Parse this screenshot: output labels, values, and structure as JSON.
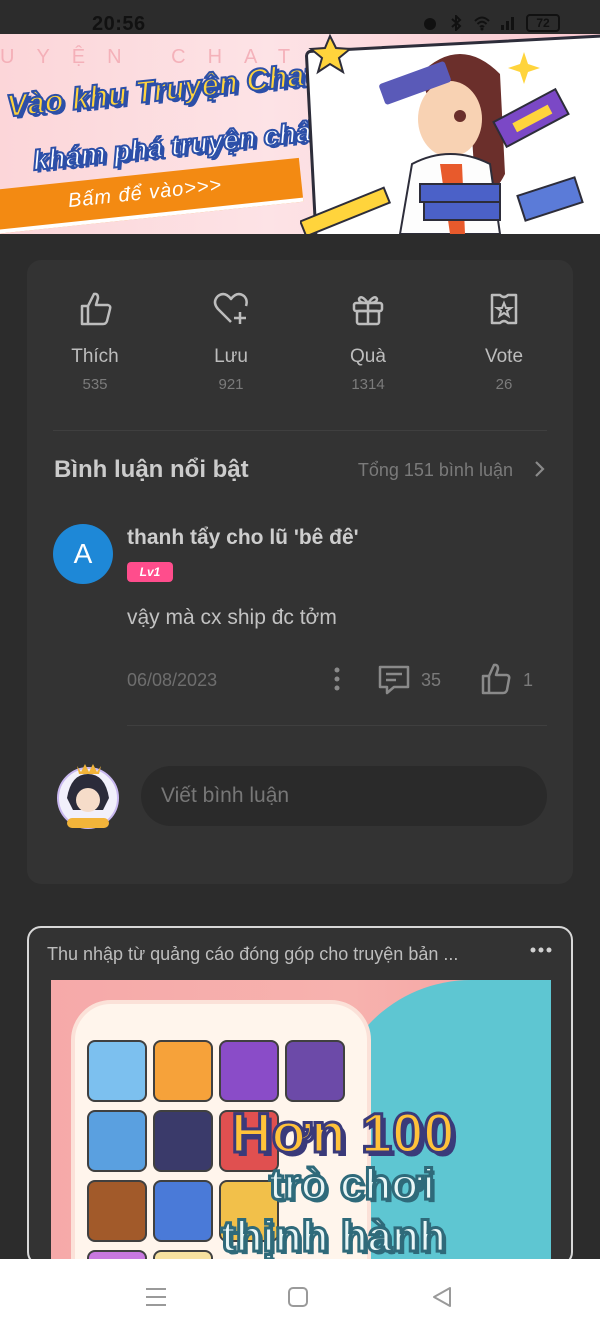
{
  "status_bar": {
    "time": "20:56",
    "battery": "72"
  },
  "banner": {
    "ghost_text": "UYỆN CHAT",
    "line1": "Vào khu Truyện Chat,",
    "line2": "khám phá truyện chất",
    "cta": "Bấm để vào>>>"
  },
  "actions": [
    {
      "label": "Thích",
      "count": "535",
      "icon": "thumbs-up-icon"
    },
    {
      "label": "Lưu",
      "count": "921",
      "icon": "heart-plus-icon"
    },
    {
      "label": "Quà",
      "count": "1314",
      "icon": "gift-icon"
    },
    {
      "label": "Vote",
      "count": "26",
      "icon": "vote-ticket-icon"
    }
  ],
  "comments_section": {
    "title": "Bình luận nổi bật",
    "total": "Tổng 151 bình luận"
  },
  "comment": {
    "avatar_letter": "A",
    "author": "thanh tẩy cho lũ 'bê đê'",
    "level": "Lv1",
    "body": "vậy mà cx ship đc tởm",
    "date": "06/08/2023",
    "replies": "35",
    "likes": "1"
  },
  "compose": {
    "placeholder": "Viết bình luận"
  },
  "ad": {
    "title": "Thu nhập từ quảng cáo đóng góp cho truyện bản ...",
    "headline1": "Hơn 100",
    "headline2": "trò chơi",
    "headline3": "thịnh hành"
  },
  "colors": {
    "background": "#2c2c2c",
    "card": "#333333",
    "avatar_blue": "#1e88d7",
    "badge_pink": "#ff4d8c",
    "banner_orange": "#f38a12"
  }
}
